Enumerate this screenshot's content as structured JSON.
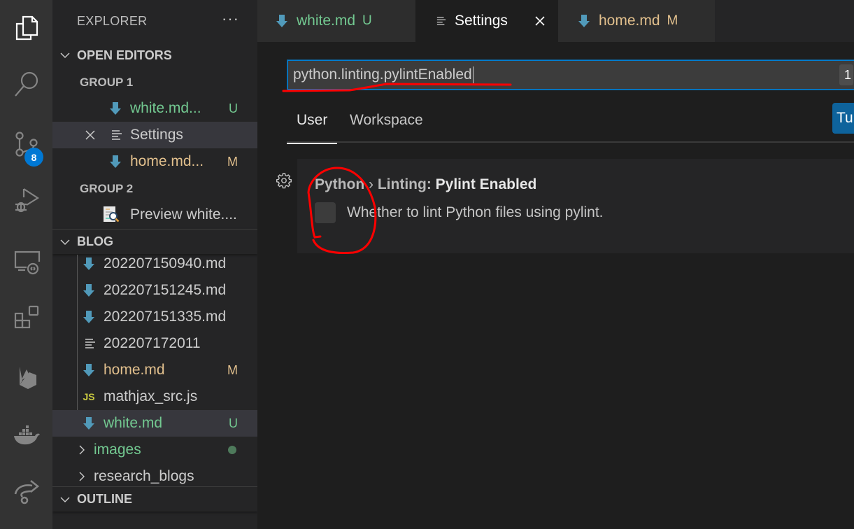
{
  "activity_bar": {
    "items": [
      {
        "name": "explorer",
        "icon": "files-icon",
        "active": true
      },
      {
        "name": "search",
        "icon": "search-icon"
      },
      {
        "name": "source-control",
        "icon": "source-control-icon",
        "badge": "8"
      },
      {
        "name": "run-and-debug",
        "icon": "debug-icon"
      },
      {
        "name": "remote-explorer",
        "icon": "remote-explorer-icon"
      },
      {
        "name": "extensions",
        "icon": "extensions-icon"
      },
      {
        "name": "firebase",
        "icon": "firebase-icon"
      },
      {
        "name": "docker",
        "icon": "docker-icon"
      },
      {
        "name": "live-share",
        "icon": "live-share-icon"
      }
    ],
    "badge_color": "#0078d4"
  },
  "sidebar": {
    "title": "EXPLORER",
    "more_label": "···",
    "open_editors": {
      "header": "OPEN EDITORS",
      "groups": [
        {
          "label": "GROUP 1",
          "items": [
            {
              "name": "white.md...",
              "icon": "markdown-icon",
              "status": "U",
              "color": "#73c991"
            },
            {
              "name": "Settings",
              "icon": "settings-lines-icon",
              "status": "",
              "selected": true,
              "close": true
            },
            {
              "name": "home.md...",
              "icon": "markdown-icon",
              "status": "M",
              "color": "#e2c08d"
            }
          ]
        },
        {
          "label": "GROUP 2",
          "items": [
            {
              "name": "Preview white....",
              "icon": "preview-icon",
              "status": ""
            }
          ]
        }
      ]
    },
    "blog": {
      "header": "BLOG",
      "files": [
        {
          "name": "202207150940.md",
          "icon": "markdown-icon",
          "status": ""
        },
        {
          "name": "202207151245.md",
          "icon": "markdown-icon",
          "status": ""
        },
        {
          "name": "202207151335.md",
          "icon": "markdown-icon",
          "status": ""
        },
        {
          "name": "202207172011",
          "icon": "text-lines-icon",
          "status": ""
        },
        {
          "name": "home.md",
          "icon": "markdown-icon",
          "status": "M"
        },
        {
          "name": "mathjax_src.js",
          "icon": "js-icon",
          "icon_text": "JS",
          "status": ""
        },
        {
          "name": "white.md",
          "icon": "markdown-icon",
          "status": "U",
          "selected": true
        }
      ],
      "folders": [
        {
          "name": "images",
          "status": "dot"
        },
        {
          "name": "research_blogs",
          "status": ""
        }
      ]
    },
    "outline": {
      "header": "OUTLINE"
    }
  },
  "tabs": [
    {
      "label": "white.md",
      "status": "U",
      "icon": "markdown-icon",
      "active": false
    },
    {
      "label": "Settings",
      "status": "",
      "icon": "settings-lines-icon",
      "active": true
    },
    {
      "label": "home.md",
      "status": "M",
      "icon": "markdown-icon",
      "active": false
    }
  ],
  "settings": {
    "search_value": "python.linting.pylintEnabled",
    "result_count": "1",
    "scopes": [
      "User",
      "Workspace"
    ],
    "active_scope": "User",
    "turn_on_label": "Tu",
    "setting": {
      "category": "Python",
      "separator": " › ",
      "subcategory": "Linting: ",
      "name": "Pylint Enabled",
      "description": "Whether to lint Python files using pylint.",
      "checked": false
    }
  },
  "colors": {
    "accent": "#007fd4",
    "button": "#0e639c",
    "untracked": "#73c991",
    "modified": "#e2c08d",
    "markdown_icon": "#519aba",
    "annotation": "#ff0000"
  }
}
